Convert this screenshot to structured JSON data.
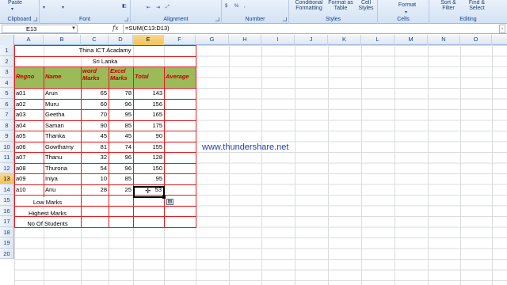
{
  "ribbon": {
    "clipboard": {
      "label": "Clipboard",
      "paste": "Paste"
    },
    "font": {
      "label": "Font"
    },
    "alignment": {
      "label": "Alignment"
    },
    "number": {
      "label": "Number",
      "currency": "$",
      "percent": "%",
      "comma": ","
    },
    "styles": {
      "label": "Styles",
      "conditional": "Conditional Formatting",
      "format_table": "Format as Table",
      "cell_styles": "Cell Styles"
    },
    "cells": {
      "label": "Cells",
      "format": "Format"
    },
    "editing": {
      "label": "Editing",
      "sort": "Sort & Filter",
      "find": "Find & Select"
    }
  },
  "formula_bar": {
    "name_box": "E13",
    "fx": "fx",
    "formula": "=SUM(C13:D13)"
  },
  "columns": [
    "A",
    "B",
    "C",
    "D",
    "E",
    "F",
    "G",
    "H",
    "I",
    "J",
    "K",
    "L",
    "M",
    "N",
    "O"
  ],
  "rows": [
    "1",
    "2",
    "3",
    "4",
    "5",
    "6",
    "7",
    "8",
    "9",
    "10",
    "11",
    "12",
    "13",
    "14",
    "15",
    "16",
    "17",
    "18",
    "19",
    "20"
  ],
  "sheet": {
    "title": "Thina ICT Acadamy",
    "subtitle": "Sri Lanka",
    "headers": {
      "regno": "Regno",
      "name": "Name",
      "word": "word Marks",
      "excel": "Excel Marks",
      "total": "Total",
      "average": "Average"
    },
    "students": [
      {
        "regno": "a01",
        "name": "Arun",
        "word": "65",
        "excel": "78",
        "total": "143"
      },
      {
        "regno": "a02",
        "name": "Muru",
        "word": "60",
        "excel": "96",
        "total": "156"
      },
      {
        "regno": "a03",
        "name": "Geetha",
        "word": "70",
        "excel": "95",
        "total": "165"
      },
      {
        "regno": "a04",
        "name": "Saman",
        "word": "90",
        "excel": "85",
        "total": "175"
      },
      {
        "regno": "a05",
        "name": "Thanka",
        "word": "45",
        "excel": "45",
        "total": "90"
      },
      {
        "regno": "a06",
        "name": "Gowthamy",
        "word": "81",
        "excel": "74",
        "total": "155"
      },
      {
        "regno": "a07",
        "name": "Thanu",
        "word": "32",
        "excel": "96",
        "total": "128"
      },
      {
        "regno": "a08",
        "name": "Thurona",
        "word": "54",
        "excel": "96",
        "total": "150"
      },
      {
        "regno": "a09",
        "name": "Iniya",
        "word": "10",
        "excel": "85",
        "total": "95"
      },
      {
        "regno": "a10",
        "name": "Anu",
        "word": "28",
        "excel": "25",
        "total": "53"
      }
    ],
    "summary": {
      "low": "Low Marks",
      "high": "Highest Marks",
      "count": "No Of Students"
    },
    "website": "www.thundershare.net"
  },
  "colors": {
    "header_fill": "#9bbb59",
    "header_text": "#c00000",
    "border_red": "#e02020",
    "link": "#1f3fb0"
  }
}
